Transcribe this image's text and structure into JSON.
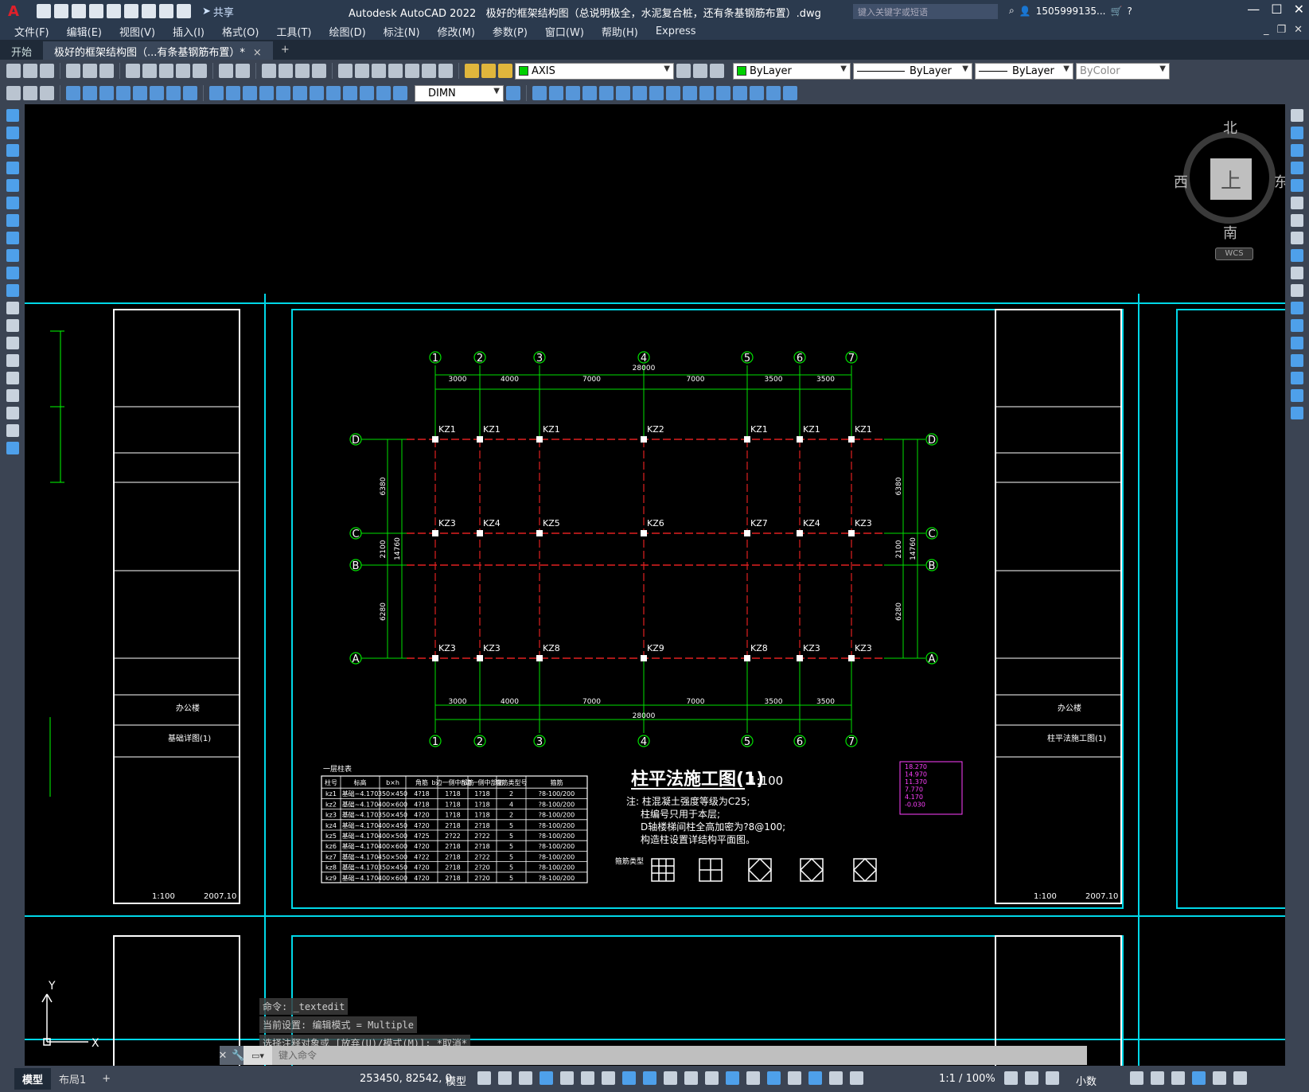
{
  "app": {
    "title": "Autodesk AutoCAD 2022",
    "document": "极好的框架结构图（总说明极全，水泥复合桩，还有条基钢筋布置）.dwg",
    "share": "共享",
    "search_placeholder": "键入关键字或短语",
    "user": "1505999135...",
    "logo": "A"
  },
  "menu": [
    "文件(F)",
    "编辑(E)",
    "视图(V)",
    "插入(I)",
    "格式(O)",
    "工具(T)",
    "绘图(D)",
    "标注(N)",
    "修改(M)",
    "参数(P)",
    "窗口(W)",
    "帮助(H)",
    "Express"
  ],
  "tabs": {
    "start": "开始",
    "active": "极好的框架结构图（...有条基钢筋布置）*",
    "close": "×",
    "new": "+"
  },
  "toolbar": {
    "layer": "AXIS",
    "color": "ByLayer",
    "linetype": "ByLayer",
    "lineweight": "ByLayer",
    "plotstyle": "ByColor",
    "dimstyle": "DIMN"
  },
  "viewcube": {
    "north": "北",
    "south": "南",
    "east": "东",
    "west": "西",
    "top": "上",
    "wcs": "WCS"
  },
  "drawing": {
    "title": "柱平法施工图(1)",
    "scale": "1:100",
    "axes_num": [
      "1",
      "2",
      "3",
      "4",
      "5",
      "6",
      "7"
    ],
    "axes_letter": [
      "D",
      "C",
      "B",
      "A"
    ],
    "spans": [
      "3000",
      "4000",
      "7000",
      "7000",
      "3500",
      "3500"
    ],
    "total": "28000",
    "row_d": [
      "KZ1",
      "KZ1",
      "KZ1",
      "KZ2",
      "KZ1",
      "KZ1",
      "KZ1"
    ],
    "row_c": [
      "KZ3",
      "KZ4",
      "KZ5",
      "KZ6",
      "KZ7",
      "KZ4",
      "KZ3"
    ],
    "row_a": [
      "KZ3",
      "KZ3",
      "KZ8",
      "KZ9",
      "KZ8",
      "KZ3",
      "KZ3"
    ],
    "vert_dims": [
      "6380",
      "2100",
      "6280"
    ],
    "vert_total": "14760",
    "notes": [
      "注: 柱混凝土强度等级为C25;",
      "柱编号只用于本层;",
      "D轴楼梯间柱全高加密为?8@100;",
      "构造柱设置详结构平面图。"
    ],
    "table_title": "一层柱表",
    "table_head": [
      "柱号",
      "标高",
      "b×h",
      "角筋",
      "b边一侧中部筋",
      "h边一侧中部筋",
      "箍筋类型号",
      "箍筋"
    ],
    "table_rows": [
      [
        "kz1",
        "基础~4.170",
        "350×450",
        "4?18",
        "1?18",
        "1?18",
        "2",
        "?8-100/200"
      ],
      [
        "kz2",
        "基础~4.170",
        "400×600",
        "4?18",
        "1?18",
        "1?18",
        "4",
        "?8-100/200"
      ],
      [
        "kz3",
        "基础~4.170",
        "350×450",
        "4?20",
        "1?18",
        "1?18",
        "2",
        "?8-100/200"
      ],
      [
        "kz4",
        "基础~4.170",
        "400×450",
        "4?20",
        "2?18",
        "2?18",
        "5",
        "?8-100/200"
      ],
      [
        "kz5",
        "基础~4.170",
        "400×500",
        "4?25",
        "2?22",
        "2?22",
        "5",
        "?8-100/200"
      ],
      [
        "kz6",
        "基础~4.170",
        "400×600",
        "4?20",
        "2?18",
        "2?18",
        "5",
        "?8-100/200"
      ],
      [
        "kz7",
        "基础~4.170",
        "450×500",
        "4?22",
        "2?18",
        "2?22",
        "5",
        "?8-100/200"
      ],
      [
        "kz8",
        "基础~4.170",
        "350×450",
        "4?20",
        "2?18",
        "2?20",
        "5",
        "?8-100/200"
      ],
      [
        "kz9",
        "基础~4.170",
        "400×600",
        "4?20",
        "2?18",
        "2?20",
        "5",
        "?8-100/200"
      ]
    ],
    "stirrup_label": "箍筋类型",
    "titleblock_left": {
      "project": "办公楼",
      "name": "基础详图(1)",
      "scale": "1:100",
      "date": "2007.10"
    },
    "titleblock_right": {
      "project": "办公楼",
      "name": "柱平法施工图(1)",
      "scale": "1:100",
      "date": "2007.10"
    },
    "levels": [
      "18.270",
      "14.970",
      "11.370",
      "7.770",
      "4.170",
      "-0.030"
    ]
  },
  "command": {
    "history": [
      "命令: _textedit",
      "当前设置: 编辑模式 = Multiple",
      "选择注释对象或 [放弃(U)/模式(M)]: *取消*"
    ],
    "placeholder": "键入命令"
  },
  "status": {
    "model_tab": "模型",
    "layout_tab": "布局1",
    "add": "+",
    "coords": "253450, 82542, 0",
    "space": "模型",
    "scale": "1:1 / 100%",
    "units": "小数"
  }
}
